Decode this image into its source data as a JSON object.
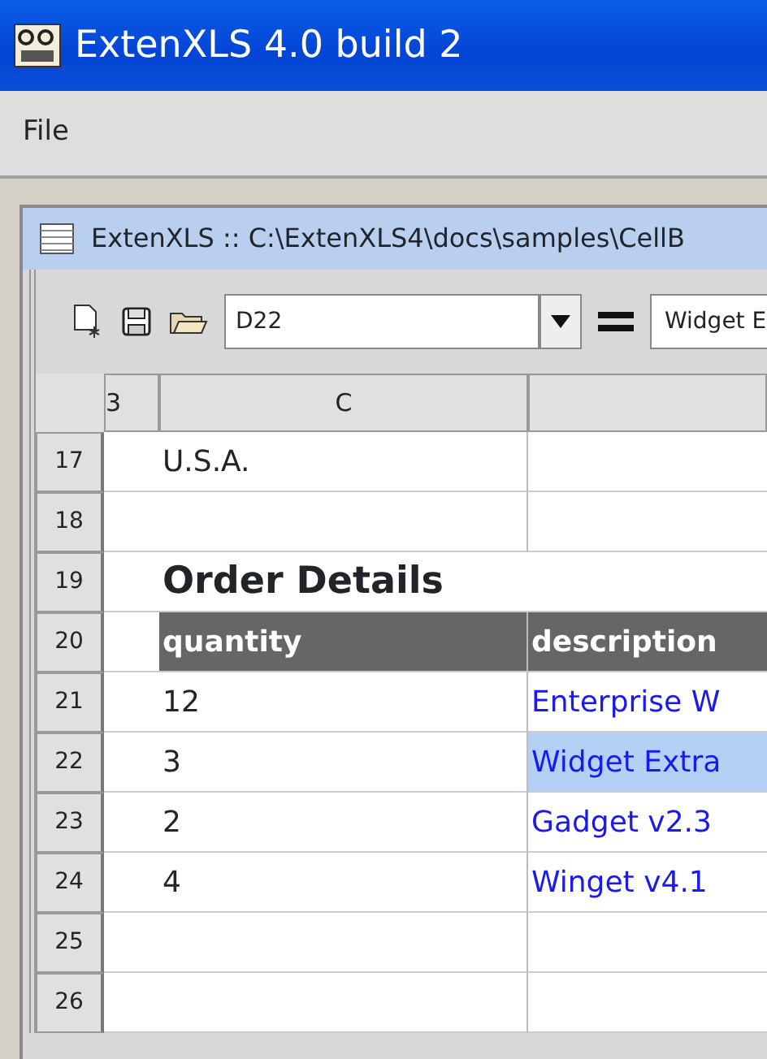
{
  "window": {
    "title": "ExtenXLS 4.0 build 2"
  },
  "menu": [
    "File"
  ],
  "document": {
    "title": "ExtenXLS :: C:\\ExtenXLS4\\docs\\samples\\CellB"
  },
  "toolbar": {
    "cell_ref": "D22",
    "formula": "Widget E"
  },
  "columns": [
    "3",
    "C"
  ],
  "rows": [
    {
      "number": "17",
      "kind": "data",
      "c": {
        "text": "U.S.A."
      }
    },
    {
      "number": "18",
      "kind": "data"
    },
    {
      "number": "19",
      "kind": "title",
      "c": {
        "text": "Order Details"
      }
    },
    {
      "number": "20",
      "kind": "header",
      "c": {
        "text": "quantity"
      },
      "d": {
        "text": "description"
      }
    },
    {
      "number": "21",
      "kind": "data",
      "c": {
        "text": "12"
      },
      "d": {
        "text": "Enterprise W",
        "link": true,
        "selected": false
      }
    },
    {
      "number": "22",
      "kind": "data",
      "c": {
        "text": "3"
      },
      "d": {
        "text": "Widget Extra",
        "link": true,
        "selected": true
      }
    },
    {
      "number": "23",
      "kind": "data",
      "c": {
        "text": "2"
      },
      "d": {
        "text": "Gadget v2.3",
        "link": true,
        "selected": false
      }
    },
    {
      "number": "24",
      "kind": "data",
      "c": {
        "text": "4"
      },
      "d": {
        "text": "Winget v4.1",
        "link": true,
        "selected": false
      }
    },
    {
      "number": "25",
      "kind": "data"
    },
    {
      "number": "26",
      "kind": "data"
    }
  ]
}
